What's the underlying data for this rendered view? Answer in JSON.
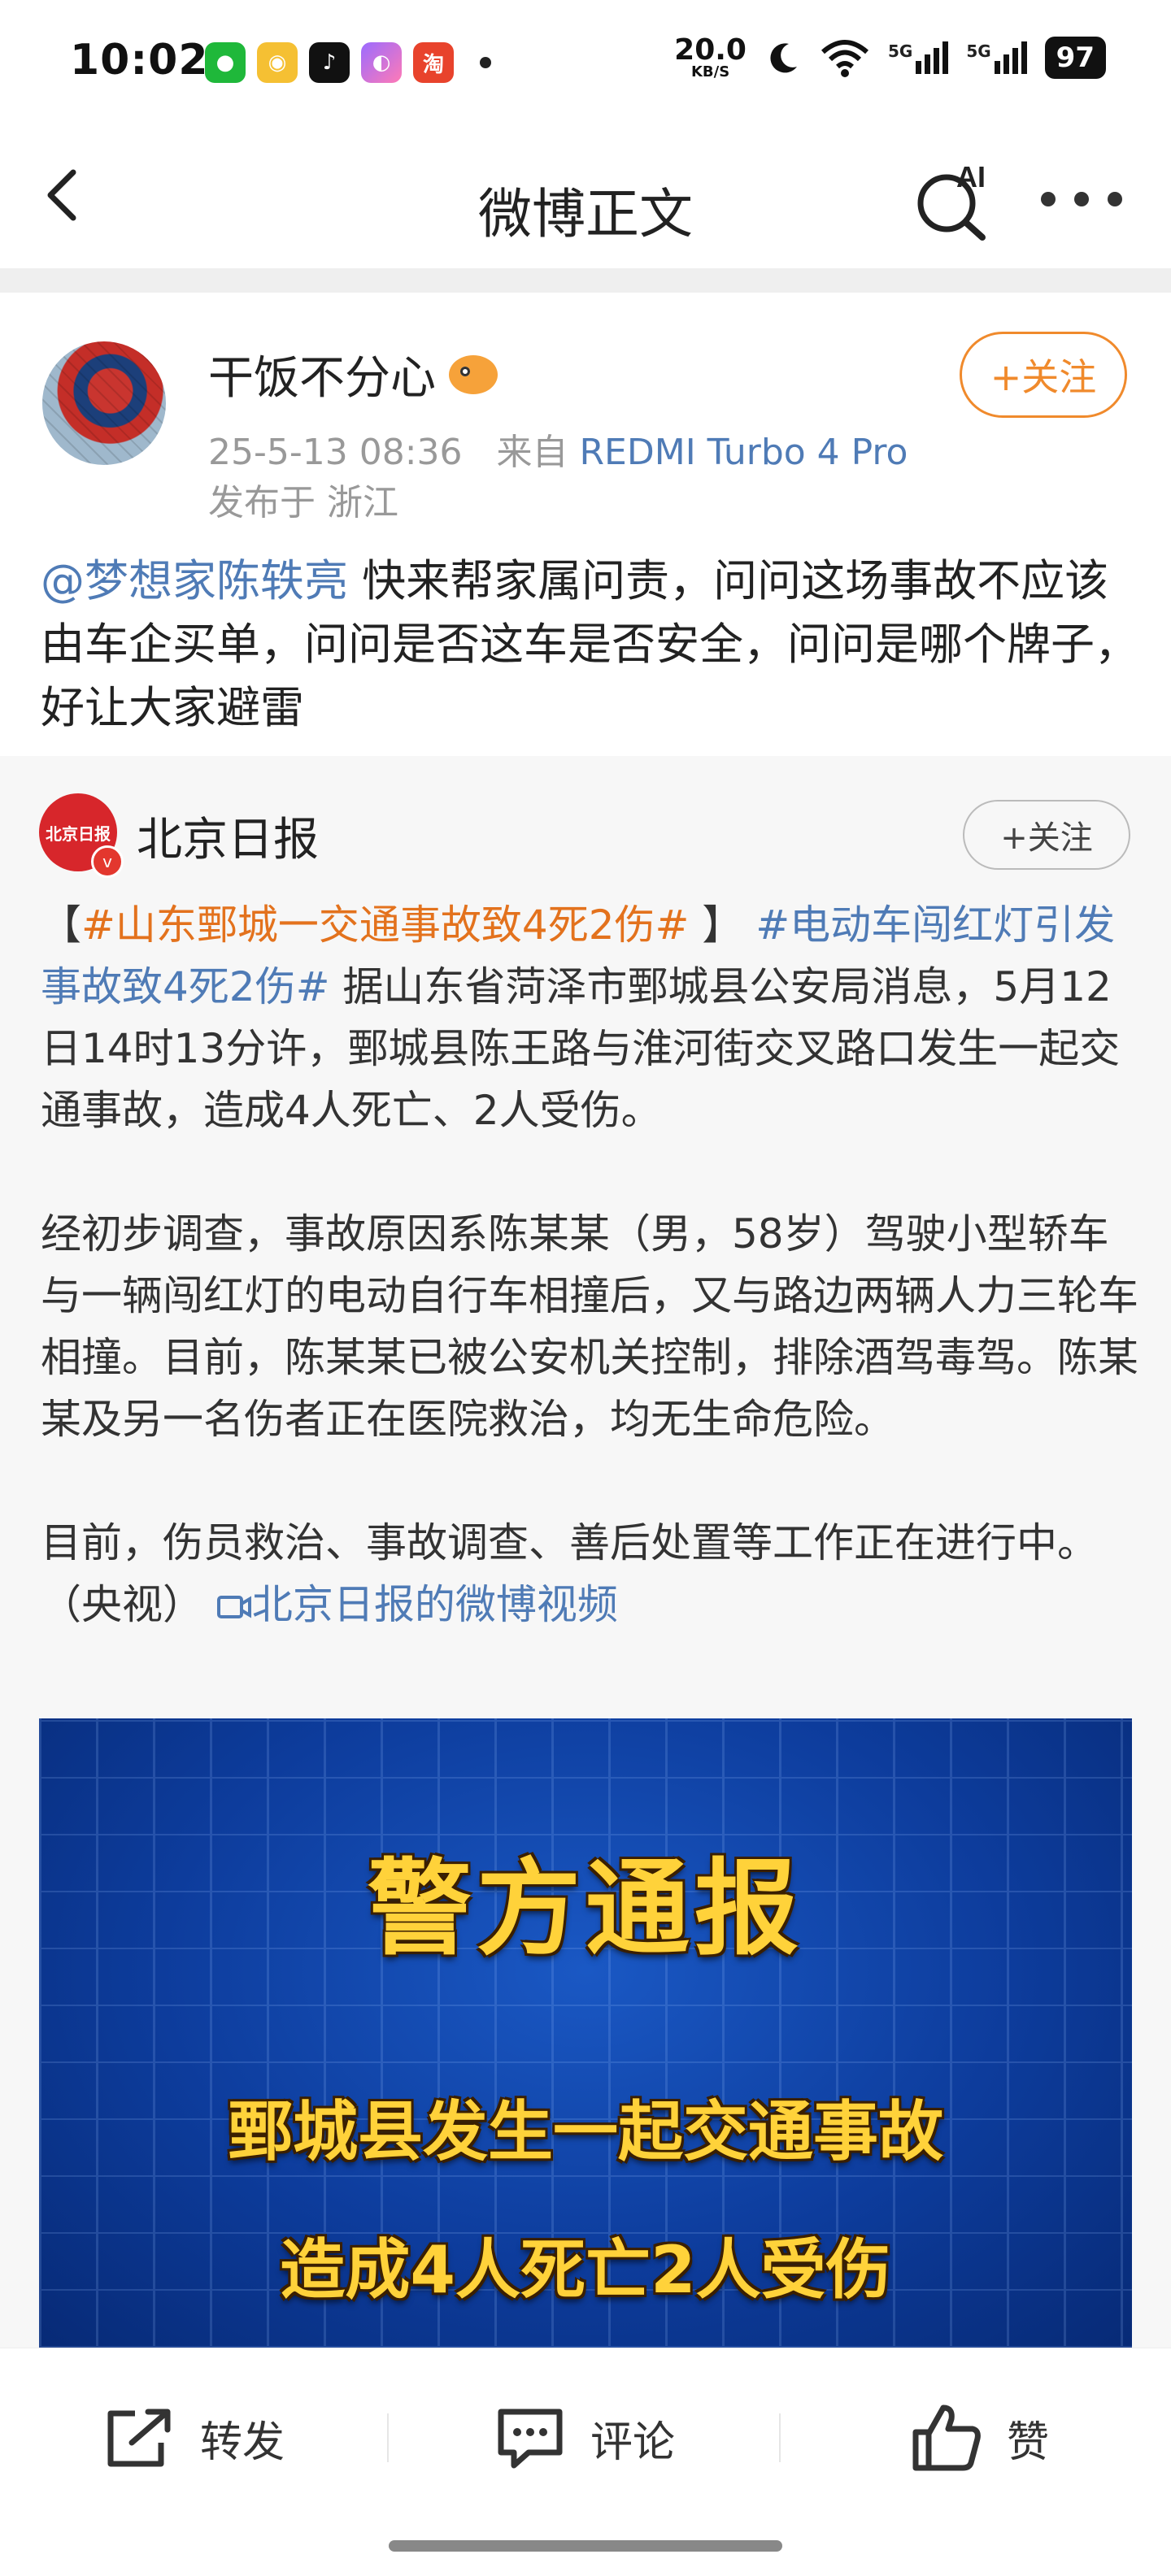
{
  "status_bar": {
    "time": "10:02",
    "net_speed": "20.0",
    "net_unit": "KB/S",
    "signal1": "5G",
    "signal2": "5G",
    "battery": "97"
  },
  "nav": {
    "title": "微博正文",
    "ai_label": "AI"
  },
  "post": {
    "author": "干饭不分心",
    "datetime": "25-5-13 08:36",
    "source_prefix": "来自",
    "device": "REDMI Turbo 4 Pro",
    "location": "发布于 浙江",
    "follow_label": "+关注",
    "mention": "@梦想家陈轶亮",
    "text": " 快来帮家属问责，问问这场事故不应该由车企买单，问问是否这车是否安全，问问是哪个牌子，好让大家避雷"
  },
  "repost": {
    "avatar_text": "北京日报",
    "name": "北京日报",
    "follow_label": "+关注",
    "bracket_open": "【",
    "topic1": "#山东鄄城一交通事故致4死2伤#",
    "bracket_close": " 】",
    "topic2": "#电动车闯红灯引发事故致4死2伤#",
    "para1": " 据山东省菏泽市鄄城县公安局消息，5月12日14时13分许，鄄城县陈王路与淮河街交叉路口发生一起交通事故，造成4人死亡、2人受伤。",
    "para2": "经初步调查，事故原因系陈某某（男，58岁）驾驶小型轿车与一辆闯红灯的电动自行车相撞后，又与路边两辆人力三轮车相撞。目前，陈某某已被公安机关控制，排除酒驾毒驾。陈某某及另一名伤者正在医院救治，均无生命危险。",
    "para3": "目前，伤员救治、事故调查、善后处置等工作正在进行中。（央视） ",
    "video_link": "北京日报的微博视频",
    "video": {
      "title": "警方通报",
      "line1": "鄄城县发生一起交通事故",
      "line2": "造成4人死亡2人受伤"
    }
  },
  "toolbar": {
    "repost": "转发",
    "comment": "评论",
    "like": "赞"
  },
  "colors": {
    "accent_orange": "#f08a2c",
    "link_blue": "#4f7bb6",
    "topic_orange": "#e3721d",
    "video_bg": "#0d3c9c",
    "caption_yellow": "#ffd23a"
  },
  "icons": [
    "back-icon",
    "ai-search-icon",
    "more-icon",
    "repost-icon",
    "comment-icon",
    "like-icon",
    "video-link-icon",
    "wifi-icon",
    "signal-icon",
    "moon-icon"
  ]
}
